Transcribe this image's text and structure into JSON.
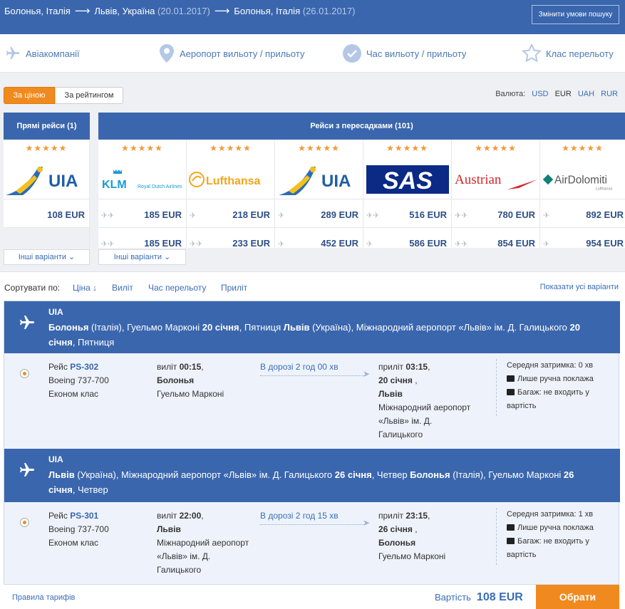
{
  "header": {
    "from1": "Болонья, Італія",
    "to1": "Львів, Україна",
    "date1": "(20.01.2017)",
    "to2": "Болонья, Італія",
    "date2": "(26.01.2017)",
    "change_btn": "Змінити умови пошуку"
  },
  "filters": {
    "airlines": "Авіакомпанії",
    "airport": "Аеропорт вильоту / прильоту",
    "time": "Час вильоту / прильоту",
    "class": "Клас перельоту"
  },
  "toggle": {
    "by_price": "За ціною",
    "by_rating": "За рейтингом"
  },
  "currency": {
    "label": "Валюта:",
    "options": [
      "USD",
      "EUR",
      "UAH",
      "RUR"
    ],
    "selected": "EUR"
  },
  "direct": {
    "header": "Прямі рейси (1)",
    "stars": "★★★★★",
    "airline": "UIA",
    "prices": [
      "108 EUR"
    ],
    "more": "Інші варіанти"
  },
  "transfers": {
    "header": "Рейси з пересадками (101)",
    "more": "Інші варіанти",
    "airlines": [
      {
        "name": "KLM",
        "sub": "Royal Dutch Airlines",
        "stars": "★★★★★",
        "p1": "185 EUR",
        "p2": "185 EUR"
      },
      {
        "name": "Lufthansa",
        "stars": "★★★★★",
        "p1": "218 EUR",
        "p2": "233 EUR"
      },
      {
        "name": "UIA",
        "stars": "★★★★★",
        "p1": "289 EUR",
        "p2": "452 EUR"
      },
      {
        "name": "SAS",
        "stars": "★★★★★",
        "p1": "516 EUR",
        "p2": "586 EUR"
      },
      {
        "name": "Austrian",
        "stars": "★★★★★",
        "p1": "780 EUR",
        "p2": "854 EUR"
      },
      {
        "name": "AirDolomiti",
        "sub": "Lufthansa",
        "stars": "★★★★★",
        "p1": "892 EUR",
        "p2": "954 EUR"
      }
    ]
  },
  "sort": {
    "label": "Сортувати по:",
    "price": "Ціна ↓",
    "departure": "Виліт",
    "duration": "Час перельоту",
    "arrival": "Приліт",
    "show_all": "Показати усі варіанти"
  },
  "segments": [
    {
      "airline": "UIA",
      "p1": "Болонья",
      "p2": " (Італія), Гуельмо Марконі ",
      "p3": "20 січня",
      "p4": ", Пятниця ",
      "p5": "Львів",
      "p6": " (Україна), Міжнародний аеропорт «Львів» ім. Д. Галицького ",
      "p7": "20 січня",
      "p8": ", Пятниця",
      "flight_label": "Рейс ",
      "flight": "PS-302",
      "aircraft": "Boeing 737-700",
      "cls": "Економ клас",
      "dep_label": "виліт ",
      "dep_time": "00:15",
      "dep_city": "Болонья",
      "dep_airport": [
        "Гуельмо Марконі"
      ],
      "duration_label": "В дорозі ",
      "duration": "2 год 00 хв",
      "arr_label": "приліт ",
      "arr_time": "03:15",
      "arr_date": "20 січня",
      "arr_city": "Львів",
      "arr_airport": [
        "Міжнародний аеропорт",
        "«Львів» ім. Д.",
        "Галицького"
      ],
      "delay": "Середня затримка: 0 хв",
      "hand": "Лише ручна поклажа",
      "bag1": "Багаж: не входить у",
      "bag2": "вартість"
    },
    {
      "airline": "UIA",
      "p1": "Львів",
      "p2": " (Україна), Міжнародний аеропорт «Львів» ім. Д. Галицького ",
      "p3": "26 січня",
      "p4": ", Четвер ",
      "p5": "Болонья",
      "p6": " (Італія), Гуельмо Марконі ",
      "p7": "26 січня",
      "p8": ", Четвер",
      "flight_label": "Рейс ",
      "flight": "PS-301",
      "aircraft": "Boeing 737-700",
      "cls": "Економ клас",
      "dep_label": "виліт ",
      "dep_time": "22:00",
      "dep_city": "Львів",
      "dep_airport": [
        "Міжнародний аеропорт",
        "«Львів» ім. Д.",
        "Галицького"
      ],
      "duration_label": "В дорозі ",
      "duration": "2 год 15 хв",
      "arr_label": "приліт ",
      "arr_time": "23:15",
      "arr_date": "26 січня",
      "arr_city": "Болонья",
      "arr_airport": [
        "Гуельмо Марконі"
      ],
      "delay": "Середня затримка: 1 хв",
      "hand": "Лише ручна поклажа",
      "bag1": "Багаж: не входить у",
      "bag2": "вартість"
    }
  ],
  "footer": {
    "rules": "Правила тарифів",
    "cost_label": "Вартість",
    "cost": "108 EUR",
    "select": "Обрати"
  },
  "colors": {
    "brand": "#3a66ad",
    "accent": "#f18a1e",
    "link": "#3a6db5",
    "star": "#f09a3a"
  }
}
